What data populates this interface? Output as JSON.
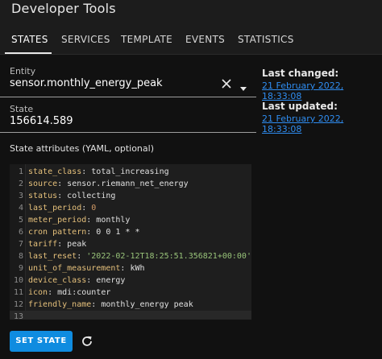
{
  "app": {
    "title": "Developer Tools"
  },
  "tabs": [
    {
      "label": "STATES"
    },
    {
      "label": "SERVICES"
    },
    {
      "label": "TEMPLATE"
    },
    {
      "label": "EVENTS"
    },
    {
      "label": "STATISTICS"
    }
  ],
  "entity": {
    "label": "Entity",
    "value": "sensor.monthly_energy_peak"
  },
  "state": {
    "label": "State",
    "value": "156614.589"
  },
  "last_changed": {
    "label": "Last changed:",
    "value": "21 February 2022, 18:33:08"
  },
  "last_updated": {
    "label": "Last updated:",
    "value": "21 February 2022, 18:33:08"
  },
  "attributes": {
    "title": "State attributes (YAML, optional)",
    "lines": [
      {
        "num": "1",
        "key": "state_class",
        "sep": ": ",
        "value": "total_increasing",
        "type": "plain"
      },
      {
        "num": "2",
        "key": "source",
        "sep": ": ",
        "value": "sensor.riemann_net_energy",
        "type": "plain"
      },
      {
        "num": "3",
        "key": "status",
        "sep": ": ",
        "value": "collecting",
        "type": "plain"
      },
      {
        "num": "4",
        "key": "last_period",
        "sep": ": ",
        "value": "0",
        "type": "number"
      },
      {
        "num": "5",
        "key": "meter_period",
        "sep": ": ",
        "value": "monthly",
        "type": "plain"
      },
      {
        "num": "6",
        "key": "cron pattern",
        "sep": ": ",
        "value": "0 0 1 * *",
        "type": "plain"
      },
      {
        "num": "7",
        "key": "tariff",
        "sep": ": ",
        "value": "peak",
        "type": "plain"
      },
      {
        "num": "8",
        "key": "last_reset",
        "sep": ": ",
        "value": "'2022-02-12T18:25:51.356821+00:00'",
        "type": "string"
      },
      {
        "num": "9",
        "key": "unit_of_measurement",
        "sep": ": ",
        "value": "kWh",
        "type": "plain"
      },
      {
        "num": "10",
        "key": "device_class",
        "sep": ": ",
        "value": "energy",
        "type": "plain"
      },
      {
        "num": "11",
        "key": "icon",
        "sep": ": ",
        "value": "mdi:counter",
        "type": "plain"
      },
      {
        "num": "12",
        "key": "friendly_name",
        "sep": ": ",
        "value": "monthly_energy peak",
        "type": "plain"
      },
      {
        "num": "13",
        "key": "",
        "sep": "",
        "value": "",
        "type": "plain"
      }
    ]
  },
  "actions": {
    "set_state_label": "SET STATE"
  },
  "icons": {
    "clear": "close-icon",
    "dropdown": "dropdown-arrow-icon",
    "refresh": "refresh-icon"
  },
  "colors": {
    "accent": "#0f8ce0",
    "link": "#2f8df1",
    "yaml_key": "#e5c07b",
    "yaml_string": "#98c379",
    "yaml_number": "#d19a66"
  }
}
